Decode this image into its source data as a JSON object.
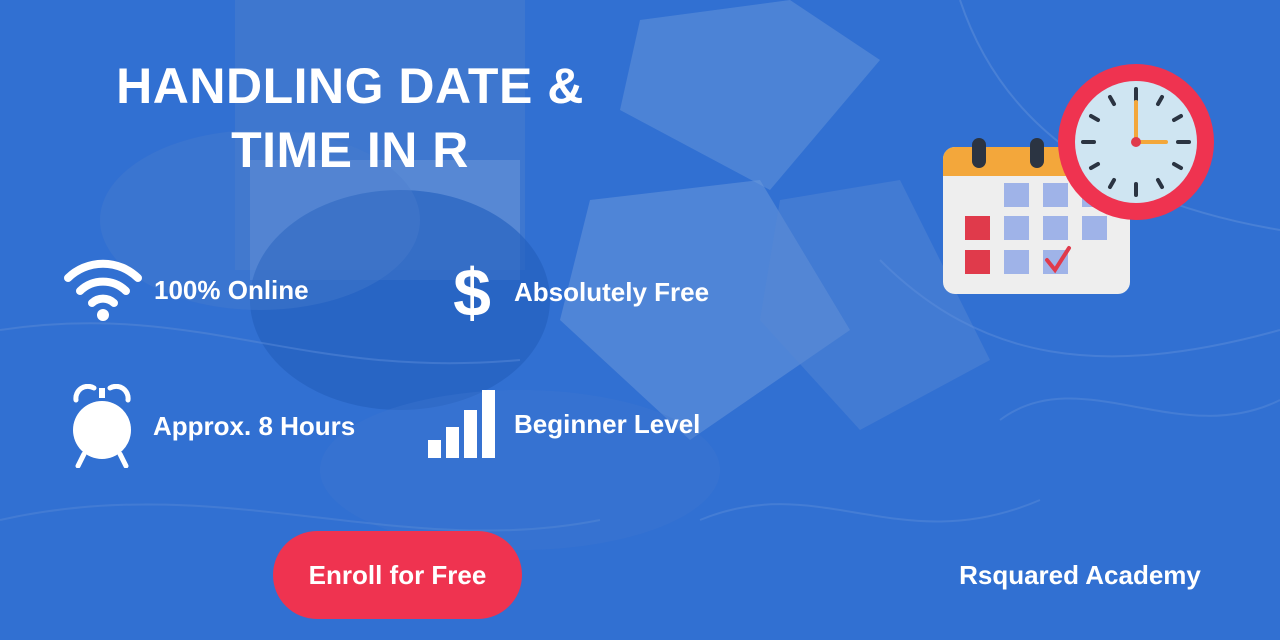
{
  "banner": {
    "title_line1": "HANDLING DATE &",
    "title_line2": "TIME IN R"
  },
  "features": {
    "online": {
      "label": "100% Online",
      "icon": "wifi-icon"
    },
    "free": {
      "label": "Absolutely Free",
      "icon": "dollar-icon"
    },
    "duration": {
      "label": "Approx. 8 Hours",
      "icon": "alarm-clock-icon"
    },
    "level": {
      "label": "Beginner Level",
      "icon": "bar-chart-icon"
    }
  },
  "cta": {
    "label": "Enroll for Free"
  },
  "brand": {
    "name": "Rsquared Academy"
  },
  "illustration": {
    "icons": [
      "calendar-icon",
      "clock-icon"
    ]
  },
  "colors": {
    "accent": "#ef3350",
    "text": "#ffffff",
    "background": "#2f6fd0"
  }
}
